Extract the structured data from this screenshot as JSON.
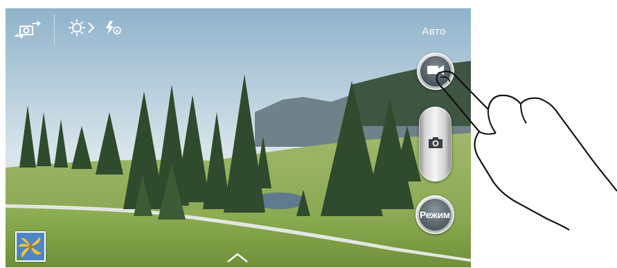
{
  "top_bar": {
    "switch_camera_icon": "switch-camera-icon",
    "settings_icon": "settings-icon",
    "flash_icon": "flash-auto-icon",
    "shooting_mode_label": "Авто"
  },
  "side_controls": {
    "record_icon": "video-camera-icon",
    "shutter_icon": "camera-icon",
    "mode_button_label": "Режим"
  },
  "bottom": {
    "gallery_thumbnail": "gallery-thumbnail",
    "expand_icon": "chevron-up-icon"
  },
  "colors": {
    "button_face": "#5a646b",
    "button_rim": "#cfcfcf",
    "label": "#ffffff"
  }
}
